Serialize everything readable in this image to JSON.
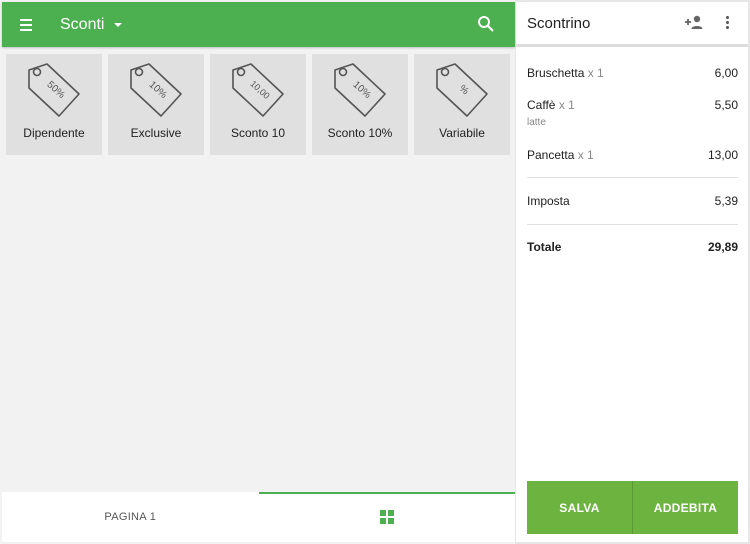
{
  "topbar": {
    "title": "Sconti"
  },
  "tiles": [
    {
      "tag": "50%",
      "label": "Dipendente"
    },
    {
      "tag": "10%",
      "label": "Exclusive"
    },
    {
      "tag": "10,00",
      "label": "Sconto 10"
    },
    {
      "tag": "10%",
      "label": "Sconto 10%"
    },
    {
      "tag": "%",
      "label": "Variabile"
    }
  ],
  "bottom_nav": {
    "page_label": "PAGINA 1"
  },
  "receipt": {
    "title": "Scontrino",
    "items": [
      {
        "name": "Bruschetta",
        "qty": "x 1",
        "price": "6,00",
        "note": ""
      },
      {
        "name": "Caffè",
        "qty": "x 1",
        "price": "5,50",
        "note": "latte"
      },
      {
        "name": "Pancetta",
        "qty": "x 1",
        "price": "13,00",
        "note": ""
      }
    ],
    "tax_label": "Imposta",
    "tax_value": "5,39",
    "total_label": "Totale",
    "total_value": "29,89",
    "save_label": "SALVA",
    "charge_label": "ADDEBITA"
  },
  "colors": {
    "primary": "#4caf50",
    "button": "#6cb33f"
  }
}
